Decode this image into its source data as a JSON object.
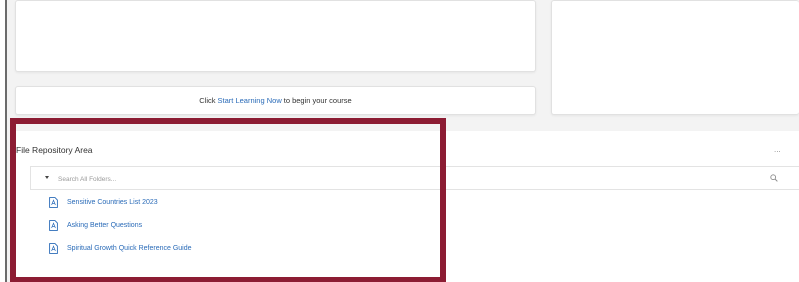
{
  "cta": {
    "prefix": "Click",
    "link": "Start Learning Now",
    "suffix": "to begin your course"
  },
  "repository": {
    "title": "File Repository Area",
    "menu_label": "...",
    "search": {
      "placeholder": "Search All Folders..."
    },
    "files": [
      {
        "label": "Sensitive Countries List 2023",
        "icon": "document-icon"
      },
      {
        "label": "Asking Better Questions",
        "icon": "document-icon"
      },
      {
        "label": "Spiritual Growth Quick Reference Guide",
        "icon": "document-icon"
      }
    ]
  },
  "colors": {
    "link": "#2a6bb8",
    "highlight_border": "#8c1c33",
    "background": "#f3f3f3"
  }
}
